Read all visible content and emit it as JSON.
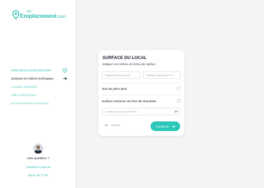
{
  "brand": {
    "prefix": "Un",
    "name": "Emplacement",
    "suffix": ".com",
    "color": "#2bbfb0"
  },
  "nav": {
    "items": [
      {
        "label": "Informations professionnelles",
        "state": "done",
        "icon": "check-circle-icon"
      },
      {
        "label": "Surfaces et critères techniques",
        "state": "active",
        "icon": "arrow-right-icon"
      },
      {
        "label": "Location souhaitée",
        "state": "pending"
      },
      {
        "label": "Villes recherchées",
        "state": "pending"
      },
      {
        "label": "Environnement commercial",
        "state": "pending"
      }
    ]
  },
  "help": {
    "title": "Une question ?",
    "link": "Contactez-nous au",
    "phone": "06 01 49 77 00"
  },
  "form": {
    "title": "SURFACE DU LOCAL",
    "subtitle": "Indiquez vos critères en termes de surface",
    "surface_min_placeholder": "Surface minimum m²",
    "surface_max_placeholder": "Surface maximum m²",
    "option_plain_pied": "Tout de plein-pied",
    "option_rdc": "Surface minimum de Rez-de-chaussée",
    "rdc_placeholder": "Surface minimum de RDC",
    "rdc_unit": "m²",
    "back_label": "Retour",
    "next_label": "Continuer"
  },
  "colors": {
    "accent": "#2bc7b8",
    "background": "#f3f4f6"
  }
}
